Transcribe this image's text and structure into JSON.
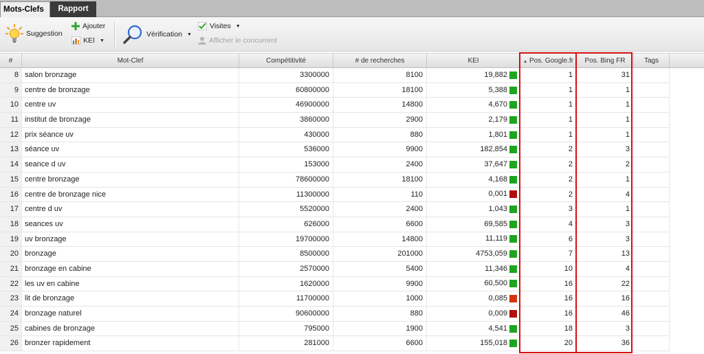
{
  "tabs": [
    {
      "label": "Mots-Clefs",
      "active": true
    },
    {
      "label": "Rapport",
      "active": false
    }
  ],
  "toolbar": {
    "suggestion": "Suggestion",
    "ajouter": "Ajouter",
    "kei": "KEI",
    "verification": "Vérification",
    "visites": "Visites",
    "afficher_concurrent": "Afficher le concurrent"
  },
  "columns": {
    "num": "#",
    "keyword": "Mot-Clef",
    "competitivite": "Compétitivité",
    "recherches": "# de recherches",
    "kei": "KEI",
    "google": "Pos. Google.fr",
    "bing": "Pos. Bing FR",
    "tags": "Tags"
  },
  "colors": {
    "kei_good": "#1ea51e",
    "kei_bad": "#b30f0f",
    "kei_medium": "#d5340f",
    "highlight": "#d40e0e"
  },
  "rows": [
    {
      "num": "8",
      "keyword": "salon bronzage",
      "comp": "3300000",
      "searches": "8100",
      "kei": "19,882",
      "kei_color": "#1ea51e",
      "google": "1",
      "bing": "31"
    },
    {
      "num": "9",
      "keyword": "centre de bronzage",
      "comp": "60800000",
      "searches": "18100",
      "kei": "5,388",
      "kei_color": "#1ea51e",
      "google": "1",
      "bing": "1"
    },
    {
      "num": "10",
      "keyword": "centre uv",
      "comp": "46900000",
      "searches": "14800",
      "kei": "4,670",
      "kei_color": "#1ea51e",
      "google": "1",
      "bing": "1"
    },
    {
      "num": "11",
      "keyword": "institut de bronzage",
      "comp": "3860000",
      "searches": "2900",
      "kei": "2,179",
      "kei_color": "#1ea51e",
      "google": "1",
      "bing": "1"
    },
    {
      "num": "12",
      "keyword": "prix séance uv",
      "comp": "430000",
      "searches": "880",
      "kei": "1,801",
      "kei_color": "#1ea51e",
      "google": "1",
      "bing": "1"
    },
    {
      "num": "13",
      "keyword": "séance uv",
      "comp": "536000",
      "searches": "9900",
      "kei": "182,854",
      "kei_color": "#1ea51e",
      "google": "2",
      "bing": "3"
    },
    {
      "num": "14",
      "keyword": "seance d uv",
      "comp": "153000",
      "searches": "2400",
      "kei": "37,647",
      "kei_color": "#1ea51e",
      "google": "2",
      "bing": "2"
    },
    {
      "num": "15",
      "keyword": "centre bronzage",
      "comp": "78600000",
      "searches": "18100",
      "kei": "4,168",
      "kei_color": "#1ea51e",
      "google": "2",
      "bing": "1"
    },
    {
      "num": "16",
      "keyword": "centre de bronzage nice",
      "comp": "11300000",
      "searches": "110",
      "kei": "0,001",
      "kei_color": "#b30f0f",
      "google": "2",
      "bing": "4"
    },
    {
      "num": "17",
      "keyword": "centre d uv",
      "comp": "5520000",
      "searches": "2400",
      "kei": "1,043",
      "kei_color": "#1ea51e",
      "google": "3",
      "bing": "1"
    },
    {
      "num": "18",
      "keyword": "seances uv",
      "comp": "626000",
      "searches": "6600",
      "kei": "69,585",
      "kei_color": "#1ea51e",
      "google": "4",
      "bing": "3"
    },
    {
      "num": "19",
      "keyword": "uv bronzage",
      "comp": "19700000",
      "searches": "14800",
      "kei": "11,119",
      "kei_color": "#1ea51e",
      "google": "6",
      "bing": "3"
    },
    {
      "num": "20",
      "keyword": "bronzage",
      "comp": "8500000",
      "searches": "201000",
      "kei": "4753,059",
      "kei_color": "#1ea51e",
      "google": "7",
      "bing": "13"
    },
    {
      "num": "21",
      "keyword": "bronzage en cabine",
      "comp": "2570000",
      "searches": "5400",
      "kei": "11,346",
      "kei_color": "#1ea51e",
      "google": "10",
      "bing": "4"
    },
    {
      "num": "22",
      "keyword": "les uv en cabine",
      "comp": "1620000",
      "searches": "9900",
      "kei": "60,500",
      "kei_color": "#1ea51e",
      "google": "16",
      "bing": "22"
    },
    {
      "num": "23",
      "keyword": "lit de bronzage",
      "comp": "11700000",
      "searches": "1000",
      "kei": "0,085",
      "kei_color": "#d5340f",
      "google": "16",
      "bing": "16"
    },
    {
      "num": "24",
      "keyword": "bronzage naturel",
      "comp": "90600000",
      "searches": "880",
      "kei": "0,009",
      "kei_color": "#b30f0f",
      "google": "16",
      "bing": "46"
    },
    {
      "num": "25",
      "keyword": "cabines de bronzage",
      "comp": "795000",
      "searches": "1900",
      "kei": "4,541",
      "kei_color": "#1ea51e",
      "google": "18",
      "bing": "3"
    },
    {
      "num": "26",
      "keyword": "bronzer rapidement",
      "comp": "281000",
      "searches": "6600",
      "kei": "155,018",
      "kei_color": "#1ea51e",
      "google": "20",
      "bing": "36"
    }
  ]
}
